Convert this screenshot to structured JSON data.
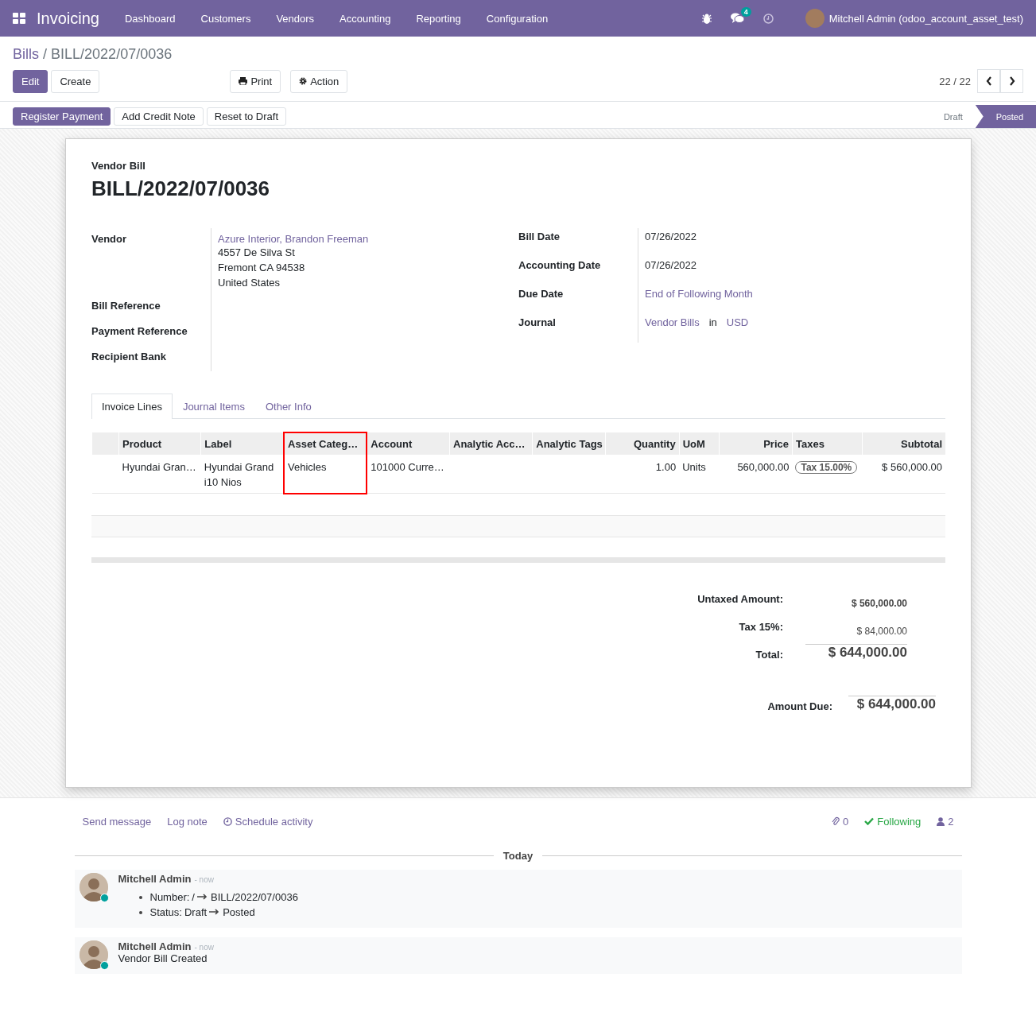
{
  "navbar": {
    "app_title": "Invoicing",
    "menus": [
      "Dashboard",
      "Customers",
      "Vendors",
      "Accounting",
      "Reporting",
      "Configuration"
    ],
    "messages_count": "4",
    "user_name": "Mitchell Admin (odoo_account_asset_test)"
  },
  "breadcrumb": {
    "parent": "Bills",
    "separator": "/",
    "current": "BILL/2022/07/0036"
  },
  "control_buttons": [
    {
      "label": "Edit",
      "primary": true
    },
    {
      "label": "Create",
      "primary": false
    }
  ],
  "action_buttons": [
    {
      "label": "Print",
      "kind": "print"
    },
    {
      "label": "Action",
      "kind": "action"
    }
  ],
  "pager": "22 / 22",
  "status_buttons": [
    {
      "label": "Register Payment",
      "primary": true
    },
    {
      "label": "Add Credit Note",
      "primary": false
    },
    {
      "label": "Reset to Draft",
      "primary": false
    }
  ],
  "stages": [
    {
      "label": "Draft",
      "selected": false
    },
    {
      "label": "Posted",
      "selected": true
    }
  ],
  "sheet": {
    "type_label": "Vendor Bill",
    "title": "BILL/2022/07/0036",
    "left_fields": [
      {
        "label": "Vendor",
        "link": "Azure Interior, Brandon Freeman",
        "lines": [
          "4557 De Silva St",
          "Fremont CA 94538",
          "United States"
        ]
      },
      {
        "label": "Bill Reference"
      },
      {
        "label": "Payment Reference"
      },
      {
        "label": "Recipient Bank"
      }
    ],
    "right_fields": [
      {
        "label": "Bill Date",
        "parts": [
          {
            "text": "07/26/2022",
            "link": false
          }
        ]
      },
      {
        "label": "Accounting Date",
        "parts": [
          {
            "text": "07/26/2022",
            "link": false
          }
        ]
      },
      {
        "label": "Due Date",
        "parts": [
          {
            "text": "End of Following Month",
            "link": true
          }
        ]
      },
      {
        "label": "Journal",
        "parts": [
          {
            "text": "Vendor Bills",
            "link": true
          },
          {
            "text": "in",
            "link": false
          },
          {
            "text": "USD",
            "link": true
          }
        ]
      }
    ],
    "tabs": [
      {
        "label": "Invoice Lines",
        "selected": true
      },
      {
        "label": "Journal Items",
        "selected": false
      },
      {
        "label": "Other Info",
        "selected": false
      }
    ],
    "columns": [
      {
        "label": "Product",
        "kind": "text",
        "highlighted": false
      },
      {
        "label": "Label",
        "kind": "text",
        "highlighted": false
      },
      {
        "label": "Asset Categ…",
        "kind": "text",
        "highlighted": true
      },
      {
        "label": "Account",
        "kind": "text",
        "highlighted": false
      },
      {
        "label": "Analytic Acc…",
        "kind": "text",
        "highlighted": false
      },
      {
        "label": "Analytic Tags",
        "kind": "text",
        "highlighted": false
      },
      {
        "label": "Quantity",
        "kind": "number",
        "highlighted": false
      },
      {
        "label": "UoM",
        "kind": "text",
        "highlighted": false
      },
      {
        "label": "Price",
        "kind": "number",
        "highlighted": false
      },
      {
        "label": "Taxes",
        "kind": "text",
        "highlighted": false
      },
      {
        "label": "Subtotal",
        "kind": "number",
        "highlighted": false
      }
    ],
    "rows": [
      {
        "cells": [
          {
            "text": "Hyundai Gran…",
            "kind": "text"
          },
          {
            "text": "Hyundai Grand i10 Nios",
            "kind": "text"
          },
          {
            "text": "Vehicles",
            "kind": "text"
          },
          {
            "text": "101000 Curre…",
            "kind": "text"
          },
          {
            "text": "",
            "kind": "empty"
          },
          {
            "text": "",
            "kind": "empty"
          },
          {
            "text": "1.00",
            "kind": "text"
          },
          {
            "text": "Units",
            "kind": "text"
          },
          {
            "text": "560,000.00",
            "kind": "text"
          },
          {
            "text": "Tax 15.00%",
            "kind": "tag"
          },
          {
            "text": "$ 560,000.00",
            "kind": "text"
          }
        ]
      }
    ],
    "totals": [
      {
        "label": "Untaxed Amount:",
        "value": "$ 560,000.00",
        "kind": "subtotal"
      },
      {
        "label": "Tax 15%:",
        "value": "$ 84,000.00",
        "kind": "tax"
      },
      {
        "label": "Total:",
        "value": "$ 644,000.00",
        "kind": "total"
      }
    ],
    "amount_due": {
      "label": "Amount Due:",
      "value": "$ 644,000.00"
    }
  },
  "chatter": {
    "actions": [
      {
        "label": "Send message",
        "kind": "plain"
      },
      {
        "label": "Log note",
        "kind": "plain"
      },
      {
        "label": "Schedule activity",
        "kind": "clock"
      }
    ],
    "attachments": "0",
    "following": "Following",
    "followers": "2",
    "day": "Today",
    "messages": [
      {
        "author": "Mitchell Admin",
        "time": "- now",
        "changes": [
          {
            "field": "Number:",
            "old": "/",
            "new": "BILL/2022/07/0036"
          },
          {
            "field": "Status:",
            "old": "Draft",
            "new": "Posted"
          }
        ]
      },
      {
        "author": "Mitchell Admin",
        "time": "- now",
        "body": "Vendor Bill Created"
      }
    ]
  }
}
